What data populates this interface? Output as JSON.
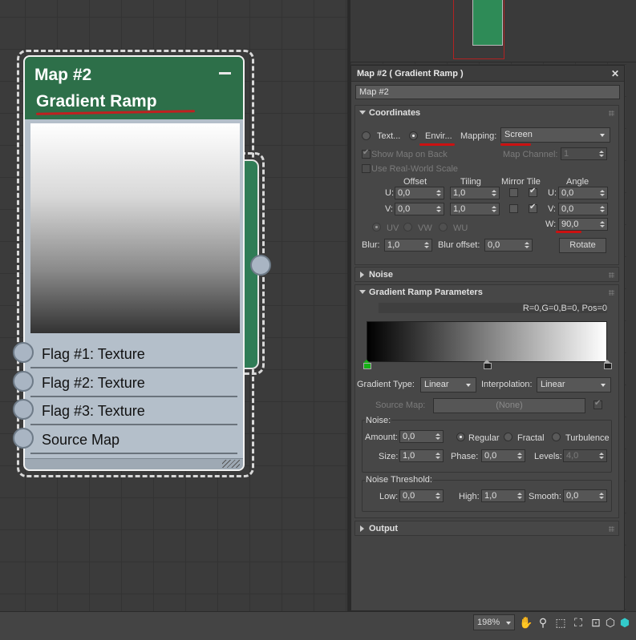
{
  "colors": {
    "node_header": "#2d6f49",
    "node_body": "#b4bfca",
    "panel_bg": "#444444",
    "annotation_red": "#cc1111",
    "active_flag": "#15b015"
  },
  "node": {
    "title": "Map #2",
    "subtitle": "Gradient Ramp",
    "minimize_icon": "minimize-icon",
    "flags": [
      "Flag #1: Texture",
      "Flag #2: Texture",
      "Flag #3: Texture",
      "Source Map"
    ]
  },
  "panel": {
    "title": "Map #2  ( Gradient Ramp )",
    "close_icon": "close-icon",
    "map_name": "Map #2",
    "coordinates": {
      "header": "Coordinates",
      "texture_label": "Text...",
      "environ_label": "Envir...",
      "mapping_label": "Mapping:",
      "mapping_value": "Screen",
      "show_map_on_back": "Show Map on Back",
      "map_channel_label": "Map Channel:",
      "map_channel_value": "1",
      "use_real_world": "Use Real-World Scale",
      "offset_label": "Offset",
      "tiling_label": "Tiling",
      "mirror_tile_label": "Mirror Tile",
      "angle_label": "Angle",
      "u_label": "U:",
      "v_label": "V:",
      "w_label": "W:",
      "offset_u": "0,0",
      "offset_v": "0,0",
      "tiling_u": "1,0",
      "tiling_v": "1,0",
      "angle_u": "0,0",
      "angle_v": "0,0",
      "angle_w": "90,0",
      "uv_label": "UV",
      "vw_label": "VW",
      "wu_label": "WU",
      "blur_label": "Blur:",
      "blur_value": "1,0",
      "blur_offset_label": "Blur offset:",
      "blur_offset_value": "0,0",
      "rotate_label": "Rotate"
    },
    "noise_rollout": {
      "header": "Noise"
    },
    "gradient_params": {
      "header": "Gradient Ramp Parameters",
      "flag_info": "R=0,G=0,B=0, Pos=0",
      "gradient_type_label": "Gradient Type:",
      "gradient_type_value": "Linear",
      "interpolation_label": "Interpolation:",
      "interpolation_value": "Linear",
      "source_map_label": "Source Map:",
      "source_map_value": "(None)",
      "noise_group": "Noise:",
      "amount_label": "Amount:",
      "amount_value": "0,0",
      "regular_label": "Regular",
      "fractal_label": "Fractal",
      "turbulence_label": "Turbulence",
      "size_label": "Size:",
      "size_value": "1,0",
      "phase_label": "Phase:",
      "phase_value": "0,0",
      "levels_label": "Levels:",
      "levels_value": "4,0",
      "noise_threshold_group": "Noise Threshold:",
      "low_label": "Low:",
      "low_value": "0,0",
      "high_label": "High:",
      "high_value": "1,0",
      "smooth_label": "Smooth:",
      "smooth_value": "0,0",
      "flag_positions": [
        0,
        50,
        100
      ]
    },
    "output_rollout": {
      "header": "Output"
    }
  },
  "status_bar": {
    "zoom": "198%",
    "icons": [
      "pan-hand-icon",
      "zoom-icon",
      "zoom-region-icon",
      "zoom-extents-icon",
      "zoom-selected-icon",
      "frame-selected-icon",
      "highlight-selected-icon"
    ]
  }
}
